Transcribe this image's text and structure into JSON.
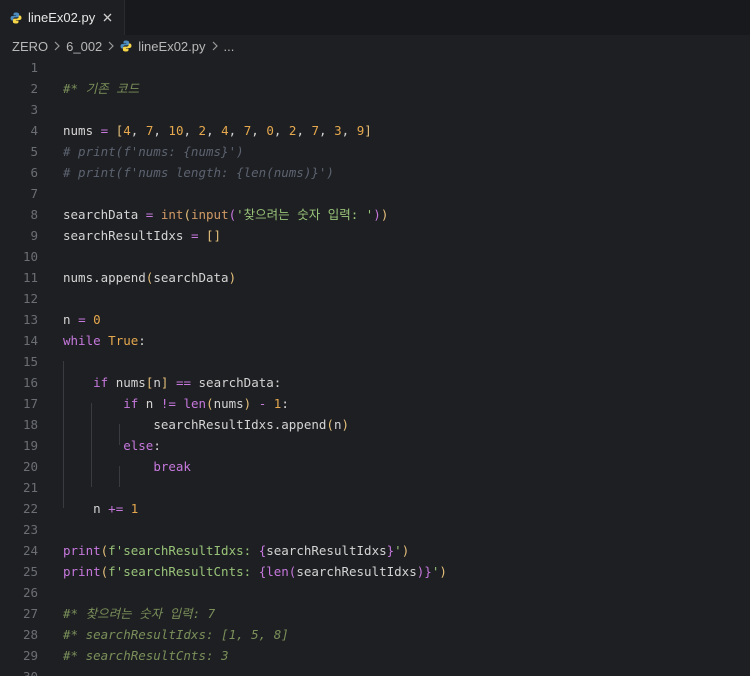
{
  "tab": {
    "label": "lineEx02.py"
  },
  "breadcrumb": {
    "items": [
      "ZERO",
      "6_002",
      "lineEx02.py",
      "..."
    ]
  },
  "editor": {
    "lines": [
      {
        "n": "1",
        "tokens": []
      },
      {
        "n": "2",
        "tokens": [
          {
            "t": "#* 기존 코드",
            "c": "tk-comment"
          }
        ]
      },
      {
        "n": "3",
        "tokens": []
      },
      {
        "n": "4",
        "tokens": [
          {
            "t": "nums ",
            "c": "tk-var"
          },
          {
            "t": "=",
            "c": "tk-op"
          },
          {
            "t": " ",
            "c": "tk-var"
          },
          {
            "t": "[",
            "c": "tk-bracket"
          },
          {
            "t": "4",
            "c": "tk-num"
          },
          {
            "t": ", ",
            "c": "tk-var"
          },
          {
            "t": "7",
            "c": "tk-num"
          },
          {
            "t": ", ",
            "c": "tk-var"
          },
          {
            "t": "10",
            "c": "tk-num"
          },
          {
            "t": ", ",
            "c": "tk-var"
          },
          {
            "t": "2",
            "c": "tk-num"
          },
          {
            "t": ", ",
            "c": "tk-var"
          },
          {
            "t": "4",
            "c": "tk-num"
          },
          {
            "t": ", ",
            "c": "tk-var"
          },
          {
            "t": "7",
            "c": "tk-num"
          },
          {
            "t": ", ",
            "c": "tk-var"
          },
          {
            "t": "0",
            "c": "tk-num"
          },
          {
            "t": ", ",
            "c": "tk-var"
          },
          {
            "t": "2",
            "c": "tk-num"
          },
          {
            "t": ", ",
            "c": "tk-var"
          },
          {
            "t": "7",
            "c": "tk-num"
          },
          {
            "t": ", ",
            "c": "tk-var"
          },
          {
            "t": "3",
            "c": "tk-num"
          },
          {
            "t": ", ",
            "c": "tk-var"
          },
          {
            "t": "9",
            "c": "tk-num"
          },
          {
            "t": "]",
            "c": "tk-bracket"
          }
        ]
      },
      {
        "n": "5",
        "tokens": [
          {
            "t": "# print(f'nums: {nums}')",
            "c": "tk-comment2"
          }
        ]
      },
      {
        "n": "6",
        "tokens": [
          {
            "t": "# print(f'nums length: {len(nums)}')",
            "c": "tk-comment2"
          }
        ]
      },
      {
        "n": "7",
        "tokens": []
      },
      {
        "n": "8",
        "tokens": [
          {
            "t": "searchData ",
            "c": "tk-var"
          },
          {
            "t": "=",
            "c": "tk-op"
          },
          {
            "t": " ",
            "c": "tk-var"
          },
          {
            "t": "int",
            "c": "tk-func"
          },
          {
            "t": "(",
            "c": "tk-bracket"
          },
          {
            "t": "input",
            "c": "tk-func"
          },
          {
            "t": "(",
            "c": "tk-bracket2"
          },
          {
            "t": "'찾으려는 숫자 입력: '",
            "c": "tk-str"
          },
          {
            "t": ")",
            "c": "tk-bracket2"
          },
          {
            "t": ")",
            "c": "tk-bracket"
          }
        ]
      },
      {
        "n": "9",
        "tokens": [
          {
            "t": "searchResultIdxs ",
            "c": "tk-var"
          },
          {
            "t": "=",
            "c": "tk-op"
          },
          {
            "t": " ",
            "c": "tk-var"
          },
          {
            "t": "[]",
            "c": "tk-bracket"
          }
        ]
      },
      {
        "n": "10",
        "tokens": []
      },
      {
        "n": "11",
        "tokens": [
          {
            "t": "nums.append",
            "c": "tk-var"
          },
          {
            "t": "(",
            "c": "tk-bracket"
          },
          {
            "t": "searchData",
            "c": "tk-var"
          },
          {
            "t": ")",
            "c": "tk-bracket"
          }
        ]
      },
      {
        "n": "12",
        "tokens": []
      },
      {
        "n": "13",
        "tokens": [
          {
            "t": "n ",
            "c": "tk-var"
          },
          {
            "t": "=",
            "c": "tk-op"
          },
          {
            "t": " ",
            "c": "tk-var"
          },
          {
            "t": "0",
            "c": "tk-num"
          }
        ]
      },
      {
        "n": "14",
        "tokens": [
          {
            "t": "while",
            "c": "tk-kw"
          },
          {
            "t": " ",
            "c": "tk-var"
          },
          {
            "t": "True",
            "c": "tk-bool"
          },
          {
            "t": ":",
            "c": "tk-var"
          }
        ]
      },
      {
        "n": "15",
        "tokens": []
      },
      {
        "n": "16",
        "tokens": [
          {
            "t": "    ",
            "c": "tk-var"
          },
          {
            "t": "if",
            "c": "tk-kw"
          },
          {
            "t": " nums",
            "c": "tk-var"
          },
          {
            "t": "[",
            "c": "tk-bracket"
          },
          {
            "t": "n",
            "c": "tk-var"
          },
          {
            "t": "]",
            "c": "tk-bracket"
          },
          {
            "t": " ",
            "c": "tk-var"
          },
          {
            "t": "==",
            "c": "tk-op"
          },
          {
            "t": " searchData:",
            "c": "tk-var"
          }
        ]
      },
      {
        "n": "17",
        "tokens": [
          {
            "t": "        ",
            "c": "tk-var"
          },
          {
            "t": "if",
            "c": "tk-kw"
          },
          {
            "t": " n ",
            "c": "tk-var"
          },
          {
            "t": "!=",
            "c": "tk-op"
          },
          {
            "t": " ",
            "c": "tk-var"
          },
          {
            "t": "len",
            "c": "tk-builtin"
          },
          {
            "t": "(",
            "c": "tk-bracket"
          },
          {
            "t": "nums",
            "c": "tk-var"
          },
          {
            "t": ")",
            "c": "tk-bracket"
          },
          {
            "t": " ",
            "c": "tk-var"
          },
          {
            "t": "-",
            "c": "tk-op"
          },
          {
            "t": " ",
            "c": "tk-var"
          },
          {
            "t": "1",
            "c": "tk-num"
          },
          {
            "t": ":",
            "c": "tk-var"
          }
        ]
      },
      {
        "n": "18",
        "tokens": [
          {
            "t": "            ",
            "c": "tk-var"
          },
          {
            "t": "searchResultIdxs.append",
            "c": "tk-var"
          },
          {
            "t": "(",
            "c": "tk-bracket"
          },
          {
            "t": "n",
            "c": "tk-var"
          },
          {
            "t": ")",
            "c": "tk-bracket"
          }
        ]
      },
      {
        "n": "19",
        "tokens": [
          {
            "t": "        ",
            "c": "tk-var"
          },
          {
            "t": "else",
            "c": "tk-kw"
          },
          {
            "t": ":",
            "c": "tk-var"
          }
        ]
      },
      {
        "n": "20",
        "tokens": [
          {
            "t": "            ",
            "c": "tk-var"
          },
          {
            "t": "break",
            "c": "tk-kw"
          }
        ]
      },
      {
        "n": "21",
        "tokens": []
      },
      {
        "n": "22",
        "tokens": [
          {
            "t": "    ",
            "c": "tk-var"
          },
          {
            "t": "n ",
            "c": "tk-var"
          },
          {
            "t": "+=",
            "c": "tk-op"
          },
          {
            "t": " ",
            "c": "tk-var"
          },
          {
            "t": "1",
            "c": "tk-num"
          }
        ]
      },
      {
        "n": "23",
        "tokens": []
      },
      {
        "n": "24",
        "tokens": [
          {
            "t": "print",
            "c": "tk-builtin"
          },
          {
            "t": "(",
            "c": "tk-bracket"
          },
          {
            "t": "f'searchResultIdxs: ",
            "c": "tk-str"
          },
          {
            "t": "{",
            "c": "tk-interp"
          },
          {
            "t": "searchResultIdxs",
            "c": "tk-var"
          },
          {
            "t": "}",
            "c": "tk-interp"
          },
          {
            "t": "'",
            "c": "tk-str"
          },
          {
            "t": ")",
            "c": "tk-bracket"
          }
        ]
      },
      {
        "n": "25",
        "tokens": [
          {
            "t": "print",
            "c": "tk-builtin"
          },
          {
            "t": "(",
            "c": "tk-bracket"
          },
          {
            "t": "f'searchResultCnts: ",
            "c": "tk-str"
          },
          {
            "t": "{",
            "c": "tk-interp"
          },
          {
            "t": "len",
            "c": "tk-builtin"
          },
          {
            "t": "(",
            "c": "tk-bracket2"
          },
          {
            "t": "searchResultIdxs",
            "c": "tk-var"
          },
          {
            "t": ")",
            "c": "tk-bracket2"
          },
          {
            "t": "}",
            "c": "tk-interp"
          },
          {
            "t": "'",
            "c": "tk-str"
          },
          {
            "t": ")",
            "c": "tk-bracket"
          }
        ]
      },
      {
        "n": "26",
        "tokens": []
      },
      {
        "n": "27",
        "tokens": [
          {
            "t": "#* 찾으려는 숫자 입력: 7",
            "c": "tk-comment"
          }
        ]
      },
      {
        "n": "28",
        "tokens": [
          {
            "t": "#* searchResultIdxs: [1, 5, 8]",
            "c": "tk-comment"
          }
        ]
      },
      {
        "n": "29",
        "tokens": [
          {
            "t": "#* searchResultCnts: 3",
            "c": "tk-comment"
          }
        ]
      },
      {
        "n": "30",
        "tokens": []
      }
    ]
  }
}
